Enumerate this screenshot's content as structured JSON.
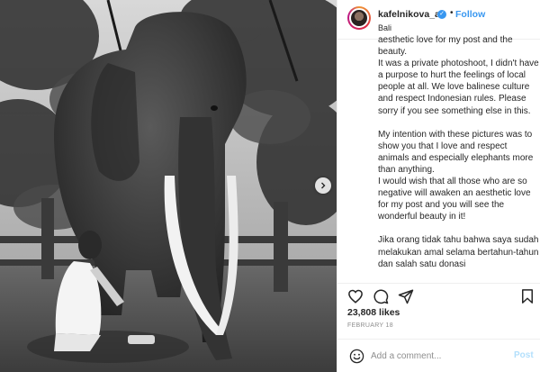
{
  "post": {
    "username": "kafelnikova_a",
    "verified_mark": "✓",
    "separator": "•",
    "follow_label": "Follow",
    "location": "Bali",
    "caption_paragraphs": [
      "aesthetic love for my post and the beauty.\nIt was a private photoshoot, I didn't have a purpose to hurt the feelings of local people at all. We love balinese culture and respect Indonesian rules. Please sorry if you see something else in this.",
      "My intention with these pictures was to show you that I love and respect animals and especially elephants more than anything.\nI would wish that all those who are so negative will awaken an aesthetic love for my post and you will see the wonderful beauty in it!",
      "Jika orang tidak tahu bahwa saya sudah melakukan amal selama bertahun-tahun dan salah satu donasi"
    ],
    "likes": "23,808 likes",
    "date": "FEBRUARY 18",
    "comment_placeholder": "Add a comment...",
    "post_button": "Post"
  },
  "icons": {
    "like": "heart-icon",
    "comment": "comment-icon",
    "share": "share-icon",
    "save": "bookmark-icon",
    "emoji": "emoji-icon",
    "carousel": "chevron-right-icon"
  },
  "colors": {
    "link_blue": "#3897f0",
    "verified_blue": "#3897f0",
    "post_disabled": "#b2dffc",
    "muted": "#8e8e8e"
  }
}
